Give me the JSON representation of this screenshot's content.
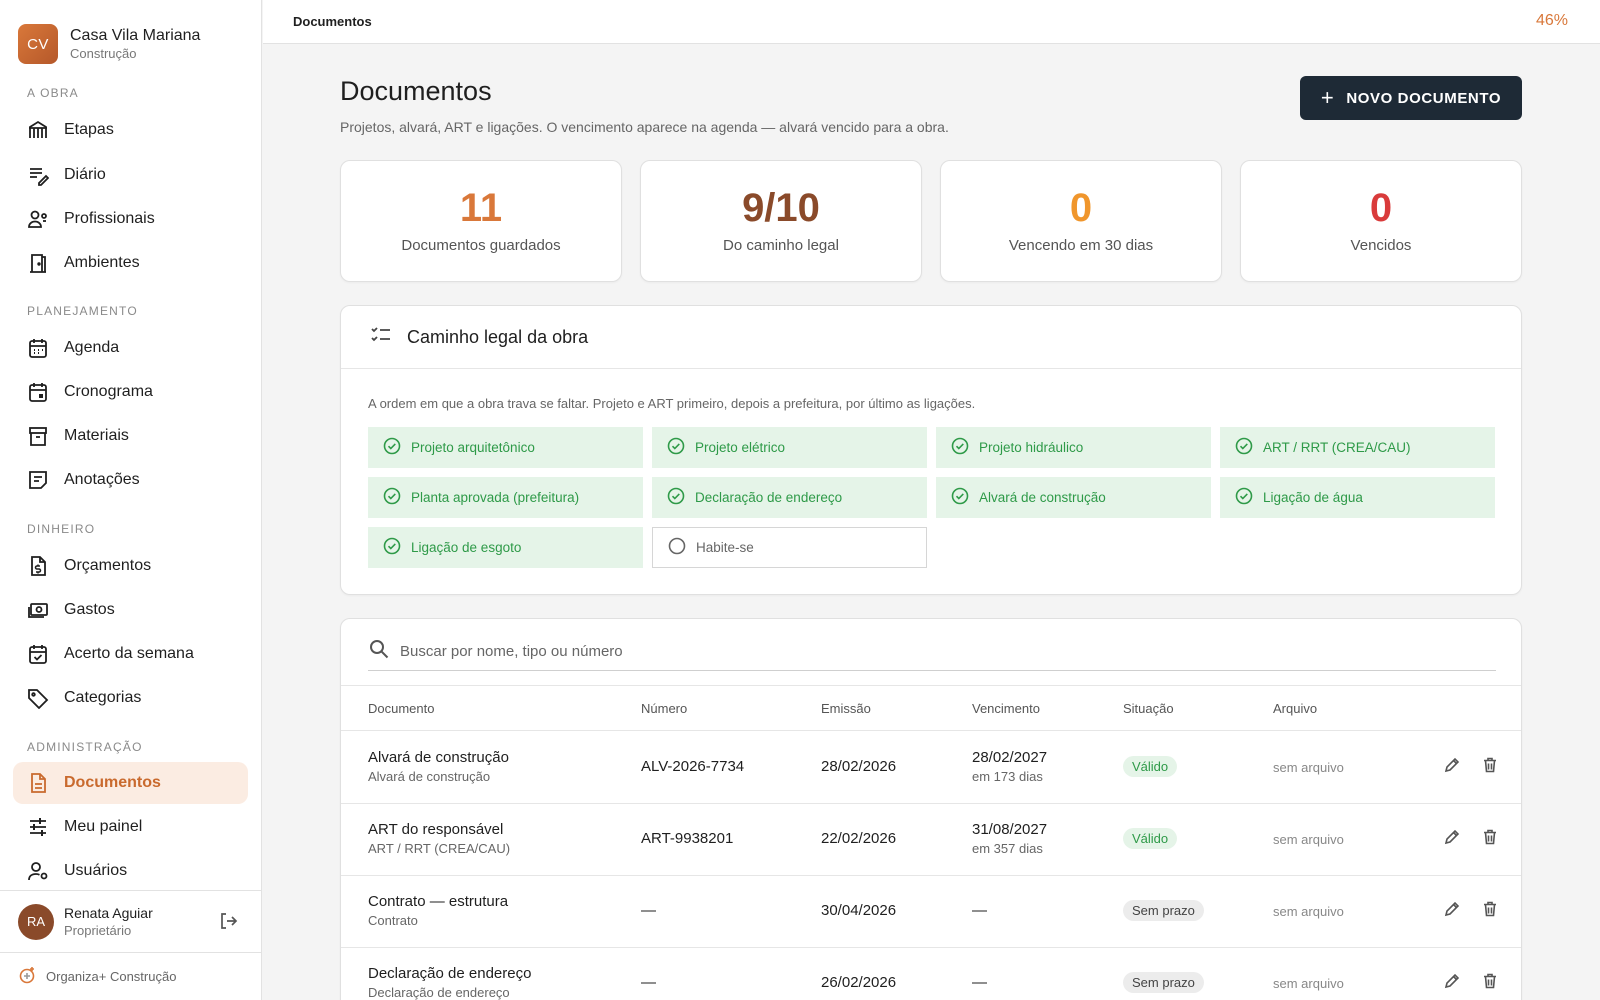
{
  "brand": {
    "initials": "CV",
    "name": "Casa Vila Mariana",
    "subtitle": "Construção"
  },
  "sidebar": {
    "sections": [
      {
        "label": "A OBRA"
      },
      {
        "label": "PLANEJAMENTO"
      },
      {
        "label": "DINHEIRO"
      },
      {
        "label": "ADMINISTRAÇÃO"
      }
    ],
    "items": [
      {
        "label": "Etapas",
        "icon": "crane-icon"
      },
      {
        "label": "Diário",
        "icon": "notes-edit-icon"
      },
      {
        "label": "Profissionais",
        "icon": "people-settings-icon"
      },
      {
        "label": "Ambientes",
        "icon": "door-icon"
      },
      {
        "label": "Agenda",
        "icon": "calendar-grid-icon"
      },
      {
        "label": "Cronograma",
        "icon": "calendar-icon"
      },
      {
        "label": "Materiais",
        "icon": "archive-box-icon"
      },
      {
        "label": "Anotações",
        "icon": "note-icon"
      },
      {
        "label": "Orçamentos",
        "icon": "document-dollar-icon"
      },
      {
        "label": "Gastos",
        "icon": "cash-icon"
      },
      {
        "label": "Acerto da semana",
        "icon": "calendar-check-icon"
      },
      {
        "label": "Categorias",
        "icon": "tag-icon"
      },
      {
        "label": "Documentos",
        "icon": "document-icon",
        "active": true
      },
      {
        "label": "Meu painel",
        "icon": "sliders-icon"
      },
      {
        "label": "Usuários",
        "icon": "user-settings-icon"
      }
    ]
  },
  "user": {
    "initials": "RA",
    "name": "Renata Aguiar",
    "role": "Proprietário"
  },
  "footer": {
    "app_name": "Organiza+ Construção"
  },
  "topbar": {
    "title": "Documentos",
    "progress": "46%"
  },
  "page": {
    "title": "Documentos",
    "subtitle": "Projetos, alvará, ART e ligações. O vencimento aparece na agenda — alvará vencido para a obra.",
    "new_button": "NOVO DOCUMENTO"
  },
  "stats": [
    {
      "value": "11",
      "label": "Documentos guardados",
      "color": "#d9783a"
    },
    {
      "value": "9/10",
      "label": "Do caminho legal",
      "color": "#8a4a2a"
    },
    {
      "value": "0",
      "label": "Vencendo em 30 dias",
      "color": "#f0962c"
    },
    {
      "value": "0",
      "label": "Vencidos",
      "color": "#d93b3b"
    }
  ],
  "legal_path": {
    "title": "Caminho legal da obra",
    "description": "A ordem em que a obra trava se faltar. Projeto e ART primeiro, depois a prefeitura, por último as ligações.",
    "steps": [
      {
        "label": "Projeto arquitetônico",
        "done": true
      },
      {
        "label": "Projeto elétrico",
        "done": true
      },
      {
        "label": "Projeto hidráulico",
        "done": true
      },
      {
        "label": "ART / RRT (CREA/CAU)",
        "done": true
      },
      {
        "label": "Planta aprovada (prefeitura)",
        "done": true
      },
      {
        "label": "Declaração de endereço",
        "done": true
      },
      {
        "label": "Alvará de construção",
        "done": true
      },
      {
        "label": "Ligação de água",
        "done": true
      },
      {
        "label": "Ligação de esgoto",
        "done": true
      },
      {
        "label": "Habite-se",
        "done": false
      }
    ]
  },
  "search": {
    "placeholder": "Buscar por nome, tipo ou número"
  },
  "table": {
    "columns": [
      "Documento",
      "Número",
      "Emissão",
      "Vencimento",
      "Situação",
      "Arquivo"
    ],
    "rows": [
      {
        "name": "Alvará de construção",
        "type": "Alvará de construção",
        "number": "ALV-2026-7734",
        "issued": "28/02/2026",
        "due": "28/02/2027",
        "due_sub": "em 173 dias",
        "status": "Válido",
        "file": "sem arquivo"
      },
      {
        "name": "ART do responsável",
        "type": "ART / RRT (CREA/CAU)",
        "number": "ART-9938201",
        "issued": "22/02/2026",
        "due": "31/08/2027",
        "due_sub": "em 357 dias",
        "status": "Válido",
        "file": "sem arquivo"
      },
      {
        "name": "Contrato — estrutura",
        "type": "Contrato",
        "number": "—",
        "issued": "30/04/2026",
        "due": "—",
        "due_sub": "",
        "status": "Sem prazo",
        "file": "sem arquivo"
      },
      {
        "name": "Declaração de endereço",
        "type": "Declaração de endereço",
        "number": "—",
        "issued": "26/02/2026",
        "due": "—",
        "due_sub": "",
        "status": "Sem prazo",
        "file": "sem arquivo"
      }
    ]
  }
}
